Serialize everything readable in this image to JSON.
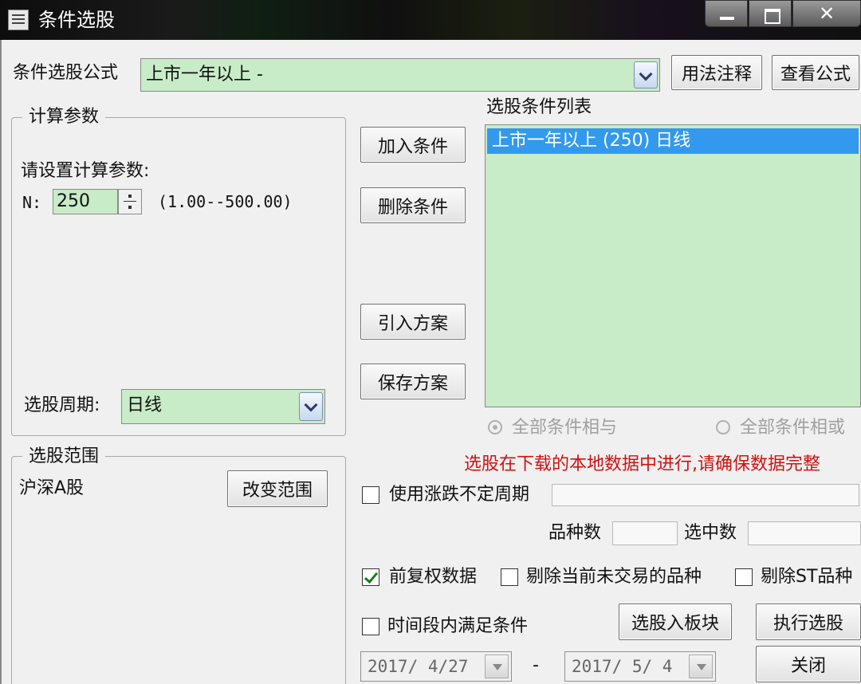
{
  "window": {
    "title": "条件选股"
  },
  "formula": {
    "label": "条件选股公式",
    "selected": "上市一年以上  -",
    "usage_button": "用法注释",
    "view_button": "查看公式"
  },
  "params": {
    "group_title": "计算参数",
    "prompt": "请设置计算参数:",
    "n_label": "N:",
    "n_value": "250",
    "n_range": "(1.00--500.00)",
    "period_label": "选股周期:",
    "period_value": "日线"
  },
  "middle_buttons": {
    "add": "加入条件",
    "delete": "删除条件",
    "import": "引入方案",
    "save": "保存方案"
  },
  "conditions": {
    "title": "选股条件列表",
    "items": [
      "上市一年以上 (250) 日线"
    ],
    "radio_and": "全部条件相与",
    "radio_or": "全部条件相或"
  },
  "range": {
    "group_title": "选股范围",
    "value": "沪深A股",
    "change_button": "改变范围"
  },
  "notice": "选股在下载的本地数据中进行,请确保数据完整",
  "options": {
    "variable_period": "使用涨跌不定周期",
    "count_label": "品种数",
    "selected_label": "选中数",
    "adjusted": "前复权数据",
    "exclude_untraded": "剔除当前未交易的品种",
    "exclude_st": "剔除ST品种",
    "time_range": "时间段内满足条件"
  },
  "dates": {
    "start": "2017/ 4/27",
    "separator": "-",
    "end": "2017/ 5/ 4"
  },
  "actions": {
    "to_block": "选股入板块",
    "execute": "执行选股",
    "close": "关闭"
  },
  "colors": {
    "green_field": "#c8ecc8",
    "selection": "#3399ee",
    "notice": "#d01010"
  }
}
